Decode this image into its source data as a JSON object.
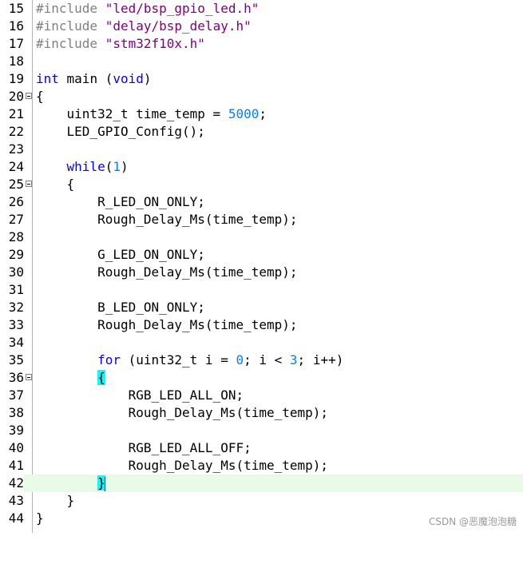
{
  "editor": {
    "lines": [
      {
        "no": "15",
        "top": 0
      },
      {
        "no": "16"
      },
      {
        "no": "17"
      },
      {
        "no": "18"
      },
      {
        "no": "19"
      },
      {
        "no": "20"
      },
      {
        "no": "21"
      },
      {
        "no": "22"
      },
      {
        "no": "23"
      },
      {
        "no": "24"
      },
      {
        "no": "25"
      },
      {
        "no": "26"
      },
      {
        "no": "27"
      },
      {
        "no": "28"
      },
      {
        "no": "29"
      },
      {
        "no": "30"
      },
      {
        "no": "31"
      },
      {
        "no": "32"
      },
      {
        "no": "33"
      },
      {
        "no": "34"
      },
      {
        "no": "35"
      },
      {
        "no": "36"
      },
      {
        "no": "37"
      },
      {
        "no": "38"
      },
      {
        "no": "39"
      },
      {
        "no": "40"
      },
      {
        "no": "41"
      },
      {
        "no": "42"
      },
      {
        "no": "43"
      },
      {
        "no": "44"
      }
    ],
    "code": {
      "l15_kw": "#include",
      "l15_str": "\"led/bsp_gpio_led.h\"",
      "l16_kw": "#include",
      "l16_str": "\"delay/bsp_delay.h\"",
      "l17_kw": "#include",
      "l17_str": "\"stm32f10x.h\"",
      "l19_type": "int",
      "l19_rest": " main (",
      "l19_void": "void",
      "l19_end": ")",
      "l20": "{",
      "l21_a": "    uint32_t time_temp = ",
      "l21_num": "5000",
      "l21_end": ";",
      "l22": "    LED_GPIO_Config();",
      "l24_kw": "while",
      "l24_a": "(",
      "l24_num": "1",
      "l24_end": ")",
      "l25": "    {",
      "l26": "        R_LED_ON_ONLY;",
      "l27": "        Rough_Delay_Ms(time_temp);",
      "l29": "        G_LED_ON_ONLY;",
      "l30": "        Rough_Delay_Ms(time_temp);",
      "l32": "        B_LED_ON_ONLY;",
      "l33": "        Rough_Delay_Ms(time_temp);",
      "l35_kw": "for",
      "l35_a": " (uint32_t i = ",
      "l35_n0": "0",
      "l35_b": "; i < ",
      "l35_n3": "3",
      "l35_c": "; i++)",
      "l36": "{",
      "l37": "            RGB_LED_ALL_ON;",
      "l38": "            Rough_Delay_Ms(time_temp);",
      "l40": "            RGB_LED_ALL_OFF;",
      "l41": "            Rough_Delay_Ms(time_temp);",
      "l42": "}",
      "l43": "    }",
      "l44": "}"
    }
  },
  "watermark": "CSDN @恶魔泡泡糖",
  "colors": {
    "preprocessor": "#808080",
    "string": "#800080",
    "keyword": "#0000ff",
    "number": "#0080ff",
    "current_line": "#e8fbe6",
    "brace_match": "#00ffff"
  }
}
